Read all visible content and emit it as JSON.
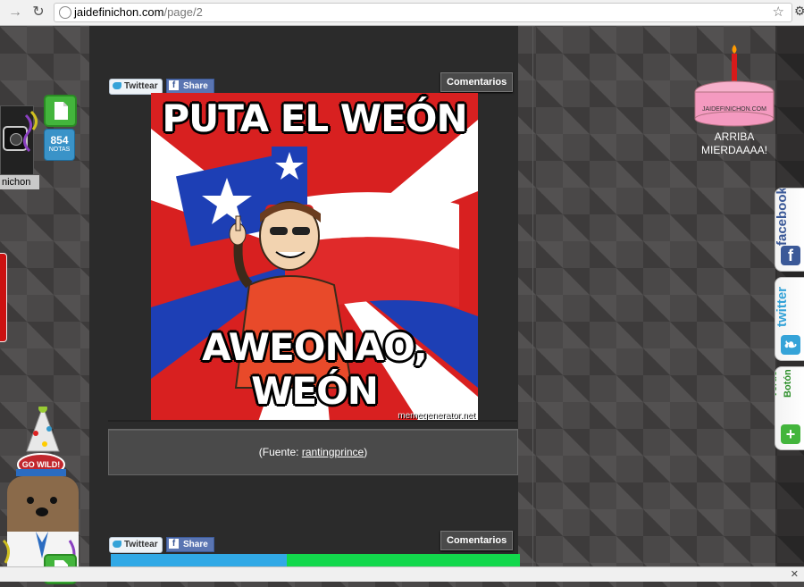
{
  "browser": {
    "back_icon": "arrow-right-icon",
    "reload_icon": "reload-icon",
    "url_host": "jaidefinichon.com",
    "url_path": "/page/2",
    "star_icon": "star-icon",
    "wrench_icon": "wrench-icon"
  },
  "post1": {
    "twitter_label": "Twittear",
    "facebook_label": "Share",
    "comments_label": "Comentarios",
    "meme_top": "PUTA EL WEÓN",
    "meme_bottom": "AWEONAO, WEÓN",
    "meme_watermark": "memegenerator.net",
    "source_prefix": "(Fuente: ",
    "source_link": "rantingprince",
    "source_suffix": ")"
  },
  "post2": {
    "twitter_label": "Twittear",
    "facebook_label": "Share",
    "comments_label": "Comentarios"
  },
  "cake": {
    "sign": "JAIDEFINICHON.COM",
    "caption_line1": "ARRIBA",
    "caption_line2": "MIERDAAAA!"
  },
  "side_tabs": {
    "facebook": "facebook",
    "twitter": "twitter",
    "boton_verde_line1": "Botón",
    "boton_verde_line2": "Verde",
    "plus": "+"
  },
  "left_widget": {
    "name": "nichon",
    "count": "854",
    "count_label": "NOTAS"
  },
  "mascot": {
    "hat_text": "GO WILD!"
  },
  "colors": {
    "twitter_blue": "#35a3d8",
    "facebook_blue": "#3b5998",
    "green": "#43b53c",
    "chile_red": "#d82020",
    "chile_blue": "#1d3fb5"
  }
}
